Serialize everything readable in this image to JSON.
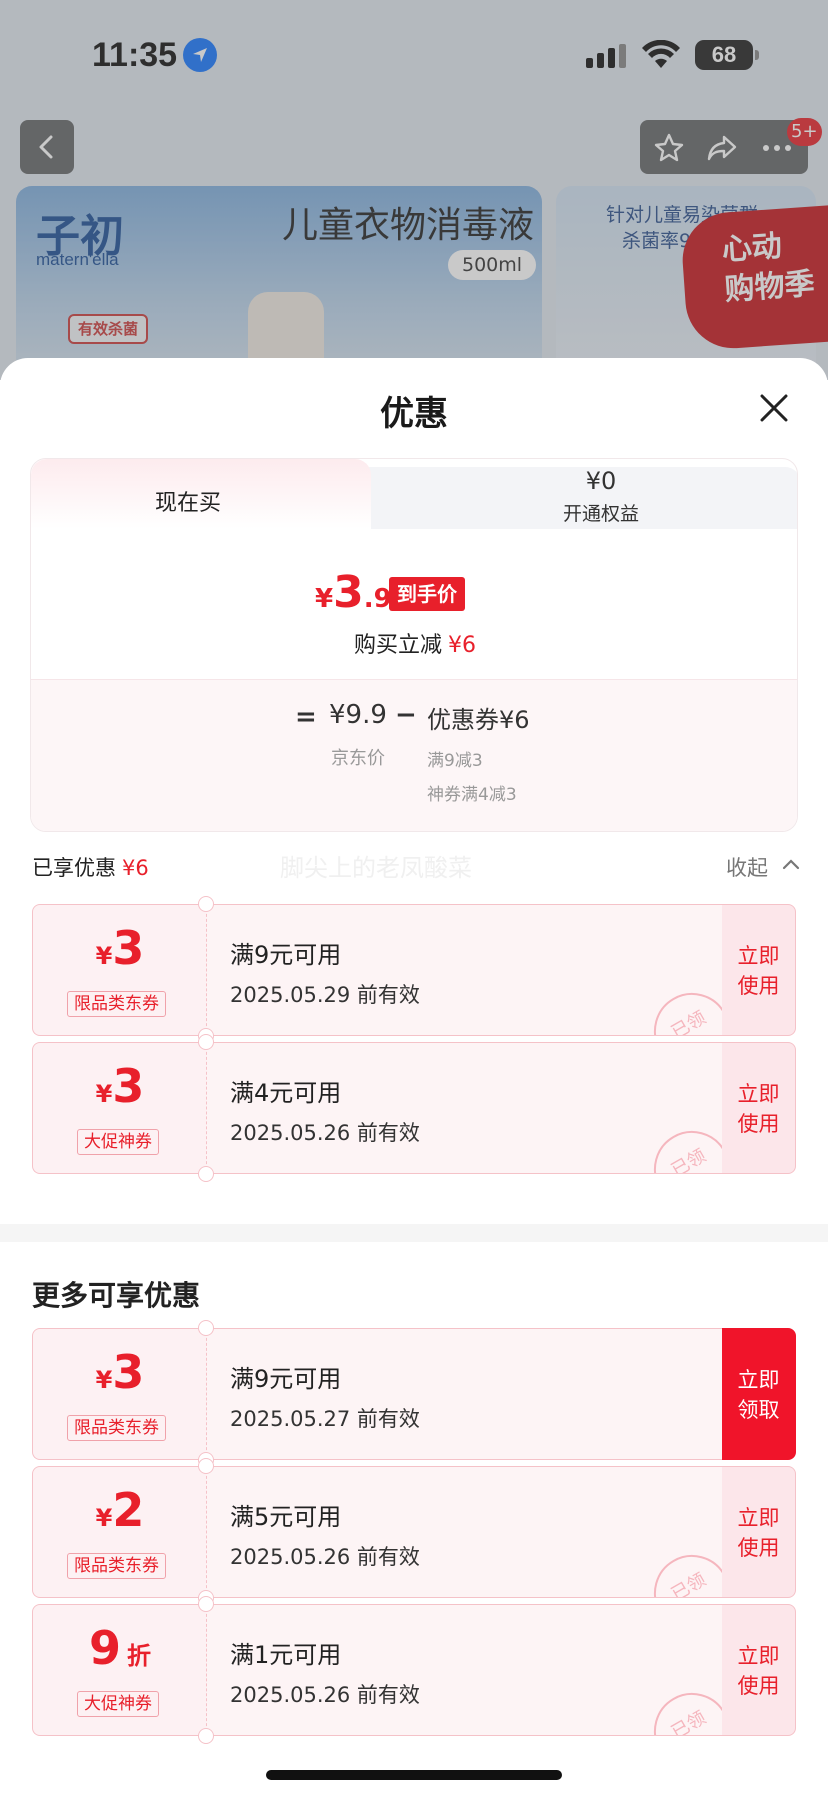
{
  "status_bar": {
    "time": "11:35",
    "battery": "68"
  },
  "product_page": {
    "cart_badge": "5+",
    "brand_logo": "子初",
    "brand_sub": "matern'ella",
    "banner_title": "儿童衣物消毒液",
    "banner_volume": "500ml",
    "banner_stamp": "有效杀菌",
    "side_text_1": "针对儿童易染菌群",
    "side_text_2": "杀菌率99",
    "promo_badge": "心动\n购物季"
  },
  "sheet": {
    "title": "优惠",
    "tabs": [
      {
        "label": "现在买"
      },
      {
        "amount": "¥0",
        "label": "开通权益"
      }
    ],
    "final_price": {
      "yen": "¥",
      "integer": "3",
      "decimal": ".9",
      "tag": "到手价"
    },
    "instant_cut": {
      "label": "购买立减",
      "amount": "¥6"
    },
    "calc": {
      "equals": "=",
      "original": "¥9.9",
      "minus": "−",
      "coupon": "优惠券¥6",
      "original_label": "京东价",
      "detail_1": "满9减3",
      "detail_2": "神券满4减3"
    },
    "enjoyed": {
      "label": "已享优惠",
      "amount": "¥6",
      "collapse": "收起"
    },
    "watermark": "脚尖上的老凤酸菜",
    "enjoyed_coupons": [
      {
        "yen": "¥",
        "amount": "3",
        "unit": "",
        "type": "限品类东券",
        "condition": "满9元可用",
        "expire": "2025.05.29 前有效",
        "action": "立即使用",
        "stamp": "已领"
      },
      {
        "yen": "¥",
        "amount": "3",
        "unit": "",
        "type": "大促神券",
        "condition": "满4元可用",
        "expire": "2025.05.26 前有效",
        "action": "立即使用",
        "stamp": "已领"
      }
    ],
    "more_title": "更多可享优惠",
    "more_coupons": [
      {
        "yen": "¥",
        "amount": "3",
        "unit": "",
        "type": "限品类东券",
        "condition": "满9元可用",
        "expire": "2025.05.27 前有效",
        "action": "立即领取",
        "stamp": ""
      },
      {
        "yen": "¥",
        "amount": "2",
        "unit": "",
        "type": "限品类东券",
        "condition": "满5元可用",
        "expire": "2025.05.26 前有效",
        "action": "立即使用",
        "stamp": "已领"
      },
      {
        "yen": "",
        "amount": "9",
        "unit": "折",
        "type": "大促神券",
        "condition": "满1元可用",
        "expire": "2025.05.26 前有效",
        "action": "立即使用",
        "stamp": "已领"
      }
    ]
  },
  "colors": {
    "accent": "#e8202b",
    "claim_bg": "#f0142a",
    "coupon_bg": "#fdf1f3"
  }
}
